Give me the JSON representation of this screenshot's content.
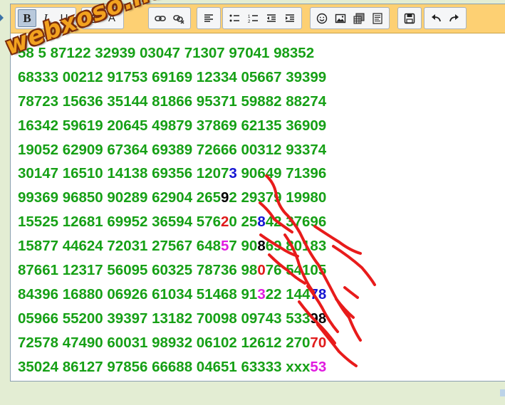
{
  "watermark": "webxoso.net",
  "toolbar": {
    "groups": [
      [
        "bold-icon",
        "italic-icon",
        "underline-icon"
      ],
      [
        "text-color-icon",
        "bg-color-icon"
      ],
      [
        "link-icon",
        "unlink-icon"
      ],
      [
        "align-left-icon"
      ],
      [
        "bulleted-list-icon",
        "numbered-list-icon",
        "outdent-icon",
        "indent-icon"
      ],
      [
        "smiley-icon",
        "image-icon",
        "table-icon",
        "page-break-icon"
      ],
      [
        "save-icon"
      ],
      [
        "undo-icon",
        "redo-icon"
      ]
    ]
  },
  "colors": {
    "default": "#16a016",
    "blue": "#1414d2",
    "black": "#000000",
    "red": "#e01b1b",
    "magenta": "#e01be0"
  },
  "rows": [
    [
      {
        "t": "58 5 87122 32939 03047 71307 97041 98352"
      }
    ],
    [
      {
        "t": "68333 00212 91753 69169 12334 05667 39399"
      }
    ],
    [
      {
        "t": "78723 15636 35144 81866 95371 59882 88274"
      }
    ],
    [
      {
        "t": "16342 59619 20645 49879 37869 62135 36909"
      }
    ],
    [
      {
        "t": "19052 62909 67364 69389 72666 00312 93374"
      }
    ],
    [
      {
        "t": "30147 16510 14138 69356 1207"
      },
      {
        "t": "3",
        "c": "blue"
      },
      {
        "t": " 90649 71396"
      }
    ],
    [
      {
        "t": "99369 96850 90289 62904 265"
      },
      {
        "t": "9",
        "c": "black"
      },
      {
        "t": "2 29379 19980"
      }
    ],
    [
      {
        "t": "15525 12681 69952 36594 576"
      },
      {
        "t": "2",
        "c": "red"
      },
      {
        "t": "0 25"
      },
      {
        "t": "8",
        "c": "blue"
      },
      {
        "t": "42 37696"
      }
    ],
    [
      {
        "t": "15877 44624 72031 27567 648"
      },
      {
        "t": "5",
        "c": "magenta"
      },
      {
        "t": "7 90"
      },
      {
        "t": "8",
        "c": "black"
      },
      {
        "t": "69 80183"
      }
    ],
    [
      {
        "t": "87661 12317 56095 60325 78736 98"
      },
      {
        "t": "0",
        "c": "red"
      },
      {
        "t": "76 54105"
      }
    ],
    [
      {
        "t": "84396 16880 06926 61034 51468 91"
      },
      {
        "t": "3",
        "c": "magenta"
      },
      {
        "t": "22 144"
      },
      {
        "t": "78",
        "c": "blue"
      }
    ],
    [
      {
        "t": "05966 55200 39397 13182 70098 09743 533"
      },
      {
        "t": "98",
        "c": "black"
      }
    ],
    [
      {
        "t": "72578 47490 60031 98932 06102 12612 270"
      },
      {
        "t": "70",
        "c": "red"
      }
    ],
    [
      {
        "t": "35024 86127 97856 66688 04651 63333 xxx"
      },
      {
        "t": "53",
        "c": "magenta"
      }
    ]
  ]
}
